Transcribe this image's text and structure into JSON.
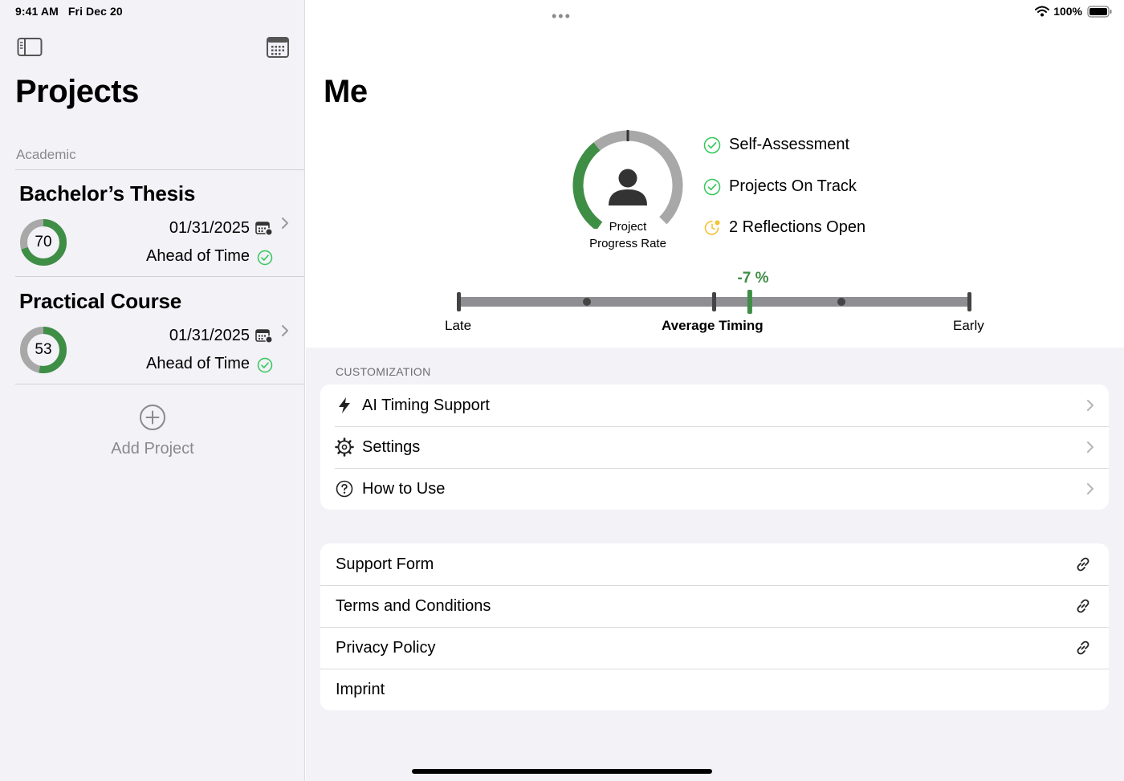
{
  "status_bar": {
    "time": "9:41 AM",
    "date": "Fri Dec 20",
    "battery": "100%"
  },
  "sidebar": {
    "title": "Projects",
    "section": "Academic",
    "projects": [
      {
        "title": "Bachelor’s Thesis",
        "progress": 70,
        "date": "01/31/2025",
        "status": "Ahead of Time"
      },
      {
        "title": "Practical Course",
        "progress": 53,
        "date": "01/31/2025",
        "status": "Ahead of Time"
      }
    ],
    "add_label": "Add Project"
  },
  "main": {
    "title": "Me",
    "gauge": {
      "label_line1": "Project",
      "label_line2": "Progress Rate",
      "fraction": 0.38
    },
    "checklist": [
      {
        "label": "Self-Assessment",
        "state": "done"
      },
      {
        "label": "Projects On Track",
        "state": "done"
      },
      {
        "label": "2 Reflections Open",
        "state": "pending"
      }
    ],
    "timing": {
      "percent": "-7 %",
      "value": -7,
      "left_label": "Late",
      "center_label": "Average Timing",
      "right_label": "Early"
    },
    "customization": {
      "header": "CUSTOMIZATION",
      "items": [
        {
          "label": "AI Timing Support",
          "icon": "bolt-icon"
        },
        {
          "label": "Settings",
          "icon": "gear-icon"
        },
        {
          "label": "How to Use",
          "icon": "question-circle-icon"
        }
      ]
    },
    "links": [
      {
        "label": "Support Form",
        "has_link": true
      },
      {
        "label": "Terms and Conditions",
        "has_link": true
      },
      {
        "label": "Privacy Policy",
        "has_link": true
      },
      {
        "label": "Imprint",
        "has_link": false
      }
    ]
  },
  "colors": {
    "green": "#3f8e46",
    "gauge_track": "#a8a8a8",
    "accent_yellow": "#f2c230",
    "check_green": "#34c759"
  }
}
